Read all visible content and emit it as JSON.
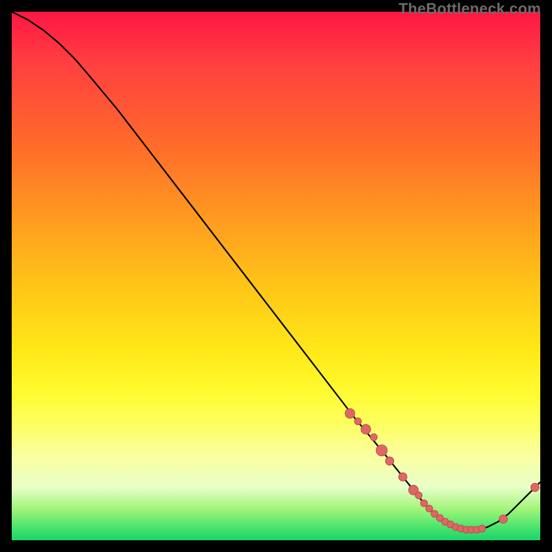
{
  "watermark": "TheBottleneck.com",
  "colors": {
    "curve": "#000000",
    "point": "#e06666",
    "point_stroke": "#b94c4c"
  },
  "chart_data": {
    "type": "line",
    "title": "",
    "xlabel": "",
    "ylabel": "",
    "xlim": [
      0,
      100
    ],
    "ylim": [
      0,
      100
    ],
    "grid": false,
    "legend": false,
    "notes": "Heat-gradient background (red high, green low) with a black bottleneck curve; salmon dots mark sampled points along the curve mostly near the minimum.",
    "series": [
      {
        "name": "bottleneck_curve",
        "x": [
          0,
          3,
          6,
          9,
          12,
          15,
          20,
          25,
          30,
          35,
          40,
          45,
          50,
          55,
          60,
          65,
          70,
          72,
          74,
          76,
          78,
          80,
          82,
          84,
          86,
          88,
          90,
          92,
          94,
          96,
          98,
          100
        ],
        "y": [
          100,
          98.5,
          96.5,
          94,
          91,
          87.5,
          81.5,
          75,
          68.5,
          62,
          55.5,
          49,
          42.5,
          36,
          29.5,
          23,
          17,
          14.5,
          12,
          9.5,
          7,
          5,
          3.5,
          2.5,
          2,
          2,
          2.5,
          3.5,
          5,
          7,
          9,
          11
        ]
      }
    ],
    "highlight_points": {
      "x": [
        64,
        65.5,
        67,
        68.5,
        70,
        71.5,
        74,
        76,
        77,
        78,
        79,
        80,
        81,
        82,
        83,
        84,
        85,
        86,
        87,
        88,
        89,
        93,
        99
      ],
      "y": [
        24,
        22.5,
        21,
        19.5,
        17,
        15,
        12,
        9.5,
        8.5,
        7,
        6,
        5,
        4.2,
        3.5,
        3,
        2.5,
        2.2,
        2,
        2,
        2,
        2.2,
        4,
        10
      ],
      "r": [
        7,
        5,
        7,
        5,
        8,
        6,
        6,
        7,
        5,
        5,
        5,
        5,
        5,
        5,
        5,
        5,
        5,
        5,
        5,
        5,
        5,
        6,
        6
      ]
    }
  }
}
